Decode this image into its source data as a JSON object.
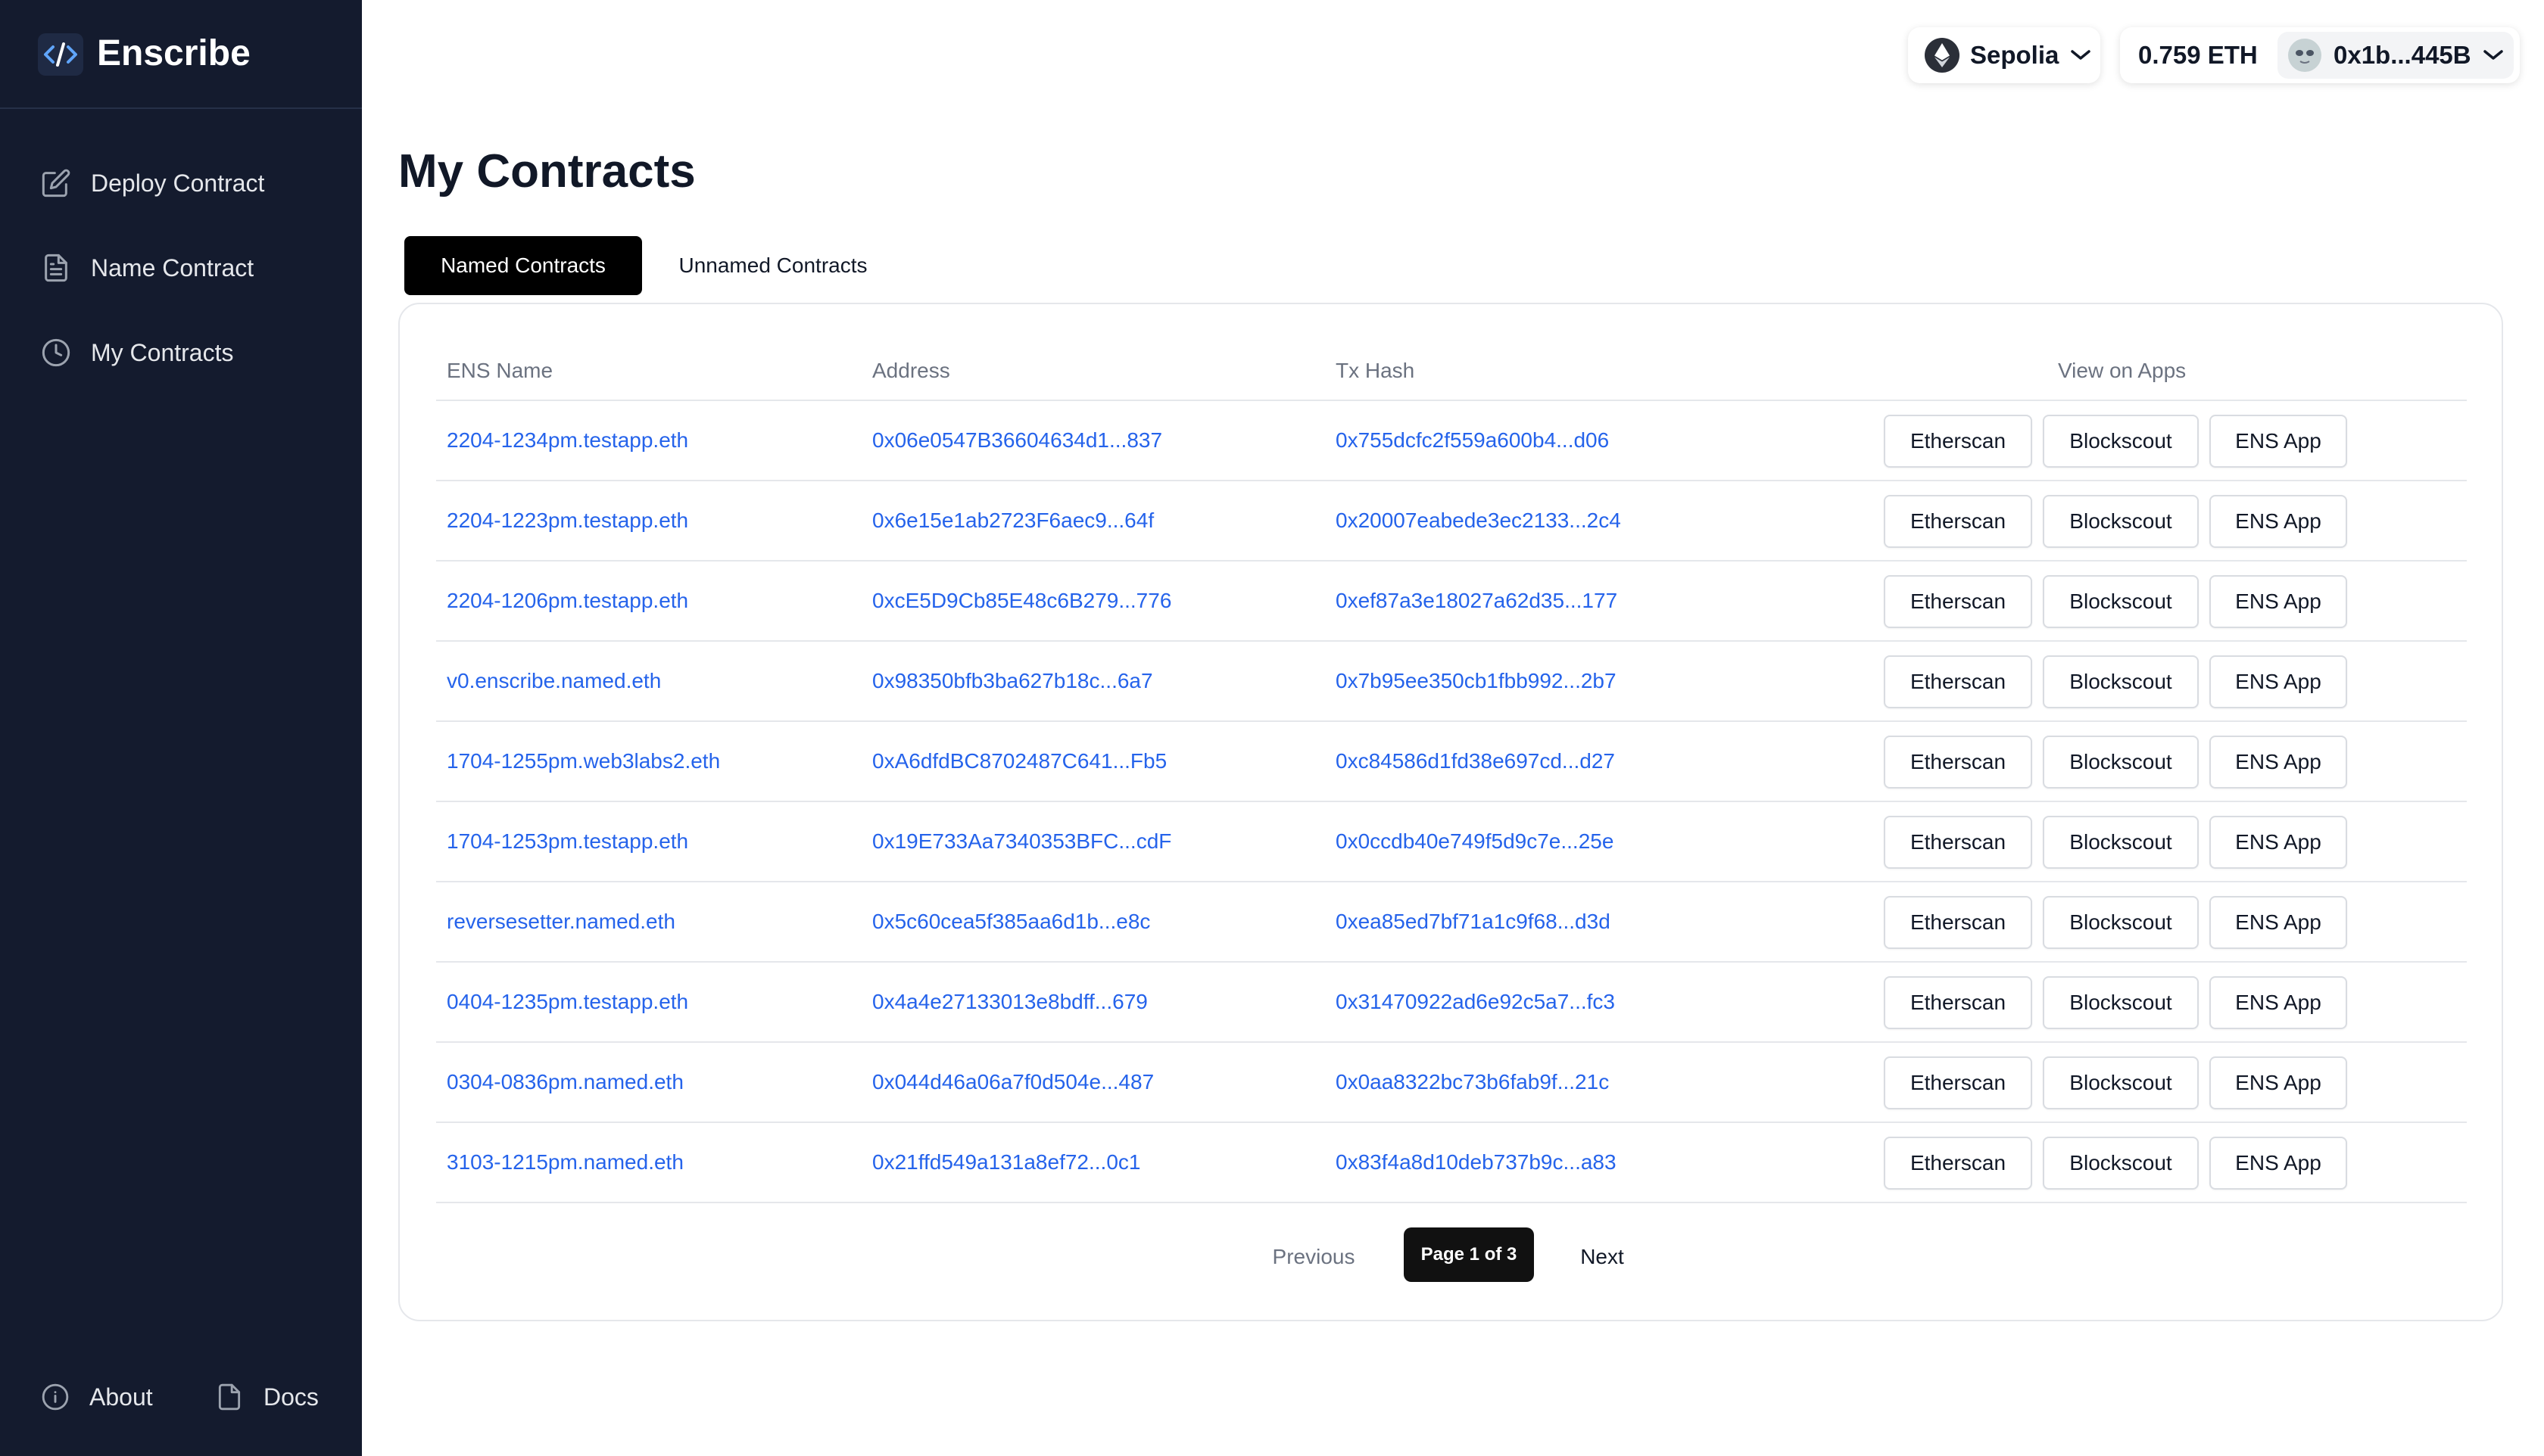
{
  "app": {
    "name": "Enscribe"
  },
  "sidebar": {
    "items": [
      {
        "label": "Deploy Contract",
        "icon": "edit-icon"
      },
      {
        "label": "Name Contract",
        "icon": "document-icon"
      },
      {
        "label": "My Contracts",
        "icon": "clock-icon"
      }
    ],
    "footer": [
      {
        "label": "About",
        "icon": "info-icon"
      },
      {
        "label": "Docs",
        "icon": "file-icon"
      }
    ]
  },
  "header": {
    "network": "Sepolia",
    "balance": "0.759 ETH",
    "account": "0x1b...445B"
  },
  "main": {
    "title": "My Contracts",
    "tabs": [
      {
        "label": "Named Contracts",
        "active": true
      },
      {
        "label": "Unnamed Contracts",
        "active": false
      }
    ],
    "table": {
      "headers": [
        "ENS Name",
        "Address",
        "Tx Hash",
        "View on Apps"
      ],
      "buttons": [
        "Etherscan",
        "Blockscout",
        "ENS App"
      ],
      "rows": [
        {
          "ens": "2204-1234pm.testapp.eth",
          "address": "0x06e0547B36604634d1...837",
          "tx": "0x755dcfc2f559a600b4...d06"
        },
        {
          "ens": "2204-1223pm.testapp.eth",
          "address": "0x6e15e1ab2723F6aec9...64f",
          "tx": "0x20007eabede3ec2133...2c4"
        },
        {
          "ens": "2204-1206pm.testapp.eth",
          "address": "0xcE5D9Cb85E48c6B279...776",
          "tx": "0xef87a3e18027a62d35...177"
        },
        {
          "ens": "v0.enscribe.named.eth",
          "address": "0x98350bfb3ba627b18c...6a7",
          "tx": "0x7b95ee350cb1fbb992...2b7"
        },
        {
          "ens": "1704-1255pm.web3labs2.eth",
          "address": "0xA6dfdBC8702487C641...Fb5",
          "tx": "0xc84586d1fd38e697cd...d27"
        },
        {
          "ens": "1704-1253pm.testapp.eth",
          "address": "0x19E733Aa7340353BFC...cdF",
          "tx": "0x0ccdb40e749f5d9c7e...25e"
        },
        {
          "ens": "reversesetter.named.eth",
          "address": "0x5c60cea5f385aa6d1b...e8c",
          "tx": "0xea85ed7bf71a1c9f68...d3d"
        },
        {
          "ens": "0404-1235pm.testapp.eth",
          "address": "0x4a4e27133013e8bdff...679",
          "tx": "0x31470922ad6e92c5a7...fc3"
        },
        {
          "ens": "0304-0836pm.named.eth",
          "address": "0x044d46a06a7f0d504e...487",
          "tx": "0x0aa8322bc73b6fab9f...21c"
        },
        {
          "ens": "3103-1215pm.named.eth",
          "address": "0x21ffd549a131a8ef72...0c1",
          "tx": "0x83f4a8d10deb737b9c...a83"
        }
      ]
    },
    "pagination": {
      "previous": "Previous",
      "label": "Page 1 of 3",
      "next": "Next"
    }
  },
  "colors": {
    "sidebar_bg": "#141b2e",
    "link": "#2563eb",
    "primary": "#000000"
  }
}
